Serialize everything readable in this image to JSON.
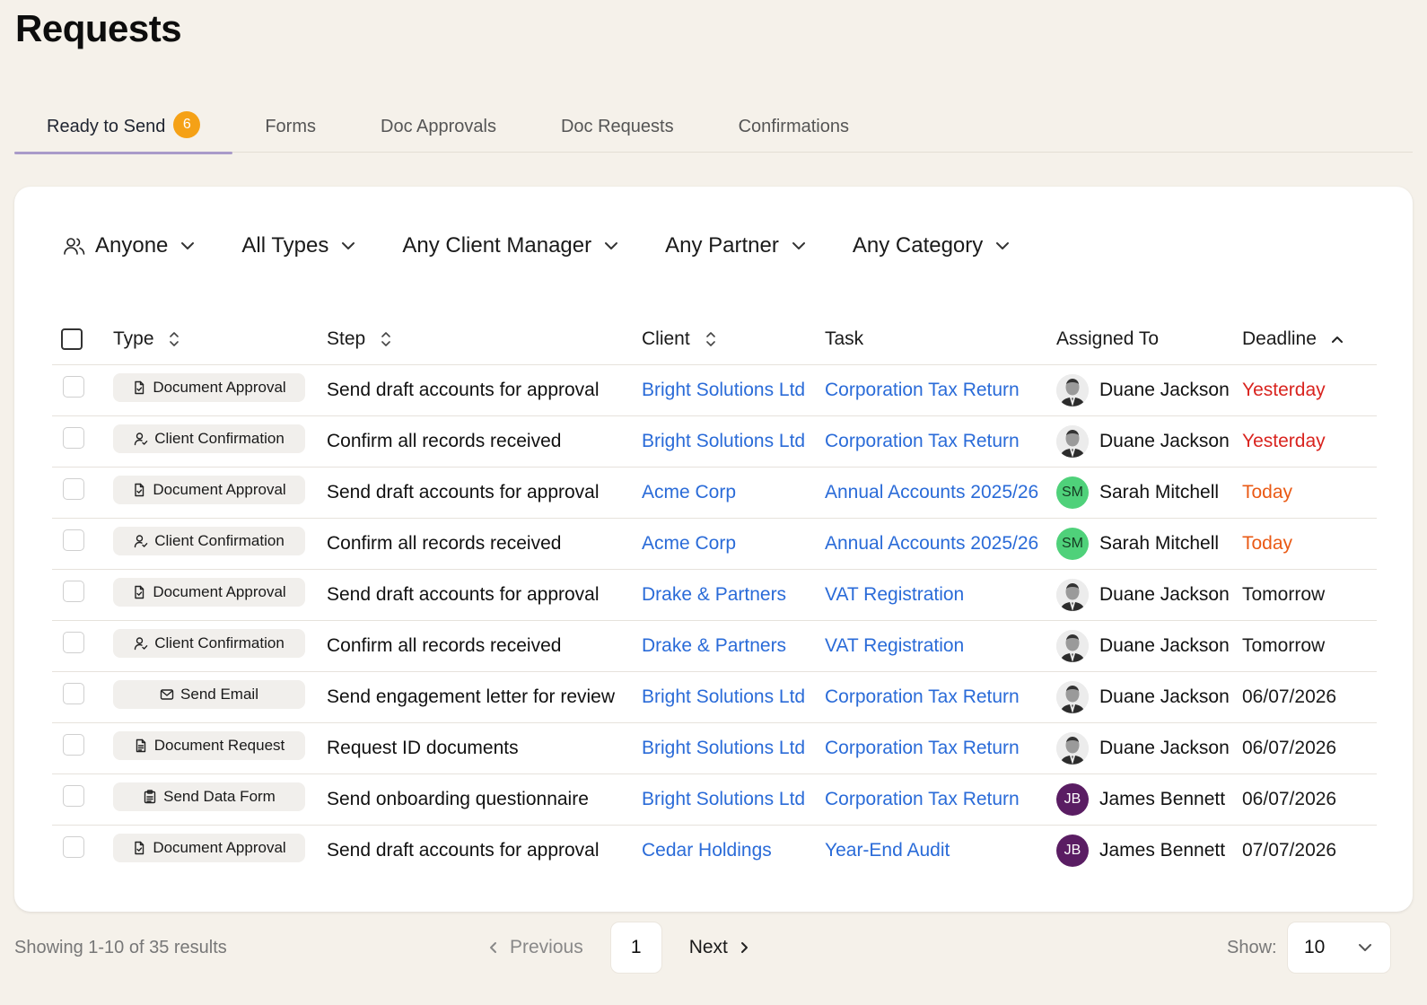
{
  "page": {
    "title": "Requests"
  },
  "tabs": [
    {
      "label": "Ready to Send",
      "badge": "6",
      "active": true
    },
    {
      "label": "Forms"
    },
    {
      "label": "Doc Approvals"
    },
    {
      "label": "Doc Requests"
    },
    {
      "label": "Confirmations"
    }
  ],
  "filters": {
    "anyone": "Anyone",
    "types": "All Types",
    "client_manager": "Any Client Manager",
    "partner": "Any Partner",
    "category": "Any Category"
  },
  "table": {
    "headers": {
      "type": "Type",
      "step": "Step",
      "client": "Client",
      "task": "Task",
      "assigned_to": "Assigned To",
      "deadline": "Deadline"
    },
    "rows": [
      {
        "type": "Document Approval",
        "type_icon": "document-check-icon",
        "step": "Send draft accounts for approval",
        "client": "Bright Solutions Ltd",
        "task": "Corporation Tax Return",
        "assignee": "Duane Jackson",
        "avatar": "photo",
        "deadline": "Yesterday",
        "deadline_status": "overdue"
      },
      {
        "type": "Client Confirmation",
        "type_icon": "user-check-icon",
        "step": "Confirm all records received",
        "client": "Bright Solutions Ltd",
        "task": "Corporation Tax Return",
        "assignee": "Duane Jackson",
        "avatar": "photo",
        "deadline": "Yesterday",
        "deadline_status": "overdue"
      },
      {
        "type": "Document Approval",
        "type_icon": "document-check-icon",
        "step": "Send draft accounts for approval",
        "client": "Acme Corp",
        "task": "Annual Accounts 2025/26",
        "assignee": "Sarah Mitchell",
        "avatar": "SM",
        "deadline": "Today",
        "deadline_status": "today"
      },
      {
        "type": "Client Confirmation",
        "type_icon": "user-check-icon",
        "step": "Confirm all records received",
        "client": "Acme Corp",
        "task": "Annual Accounts 2025/26",
        "assignee": "Sarah Mitchell",
        "avatar": "SM",
        "deadline": "Today",
        "deadline_status": "today"
      },
      {
        "type": "Document Approval",
        "type_icon": "document-check-icon",
        "step": "Send draft accounts for approval",
        "client": "Drake & Partners",
        "task": "VAT Registration",
        "assignee": "Duane Jackson",
        "avatar": "photo",
        "deadline": "Tomorrow",
        "deadline_status": "normal"
      },
      {
        "type": "Client Confirmation",
        "type_icon": "user-check-icon",
        "step": "Confirm all records received",
        "client": "Drake & Partners",
        "task": "VAT Registration",
        "assignee": "Duane Jackson",
        "avatar": "photo",
        "deadline": "Tomorrow",
        "deadline_status": "normal"
      },
      {
        "type": "Send Email",
        "type_icon": "mail-icon",
        "step": "Send engagement letter for review",
        "client": "Bright Solutions Ltd",
        "task": "Corporation Tax Return",
        "assignee": "Duane Jackson",
        "avatar": "photo",
        "deadline": "06/07/2026",
        "deadline_status": "normal"
      },
      {
        "type": "Document Request",
        "type_icon": "document-lines-icon",
        "step": "Request ID documents",
        "client": "Bright Solutions Ltd",
        "task": "Corporation Tax Return",
        "assignee": "Duane Jackson",
        "avatar": "photo",
        "deadline": "06/07/2026",
        "deadline_status": "normal"
      },
      {
        "type": "Send Data Form",
        "type_icon": "clipboard-icon",
        "step": "Send onboarding questionnaire",
        "client": "Bright Solutions Ltd",
        "task": "Corporation Tax Return",
        "assignee": "James Bennett",
        "avatar": "JB",
        "deadline": "06/07/2026",
        "deadline_status": "normal"
      },
      {
        "type": "Document Approval",
        "type_icon": "document-check-icon",
        "step": "Send draft accounts for approval",
        "client": "Cedar Holdings",
        "task": "Year-End Audit",
        "assignee": "James Bennett",
        "avatar": "JB",
        "deadline": "07/07/2026",
        "deadline_status": "normal"
      }
    ]
  },
  "footer": {
    "summary": "Showing 1-10 of 35 results",
    "previous": "Previous",
    "page": "1",
    "next": "Next",
    "show_label": "Show:",
    "show_value": "10"
  },
  "colors": {
    "background": "#f5f1ea",
    "link": "#2a6bd8",
    "badge": "#f5a116",
    "overdue": "#d9241f",
    "today": "#ea5a15",
    "active_tab_underline": "#a99bc9"
  }
}
